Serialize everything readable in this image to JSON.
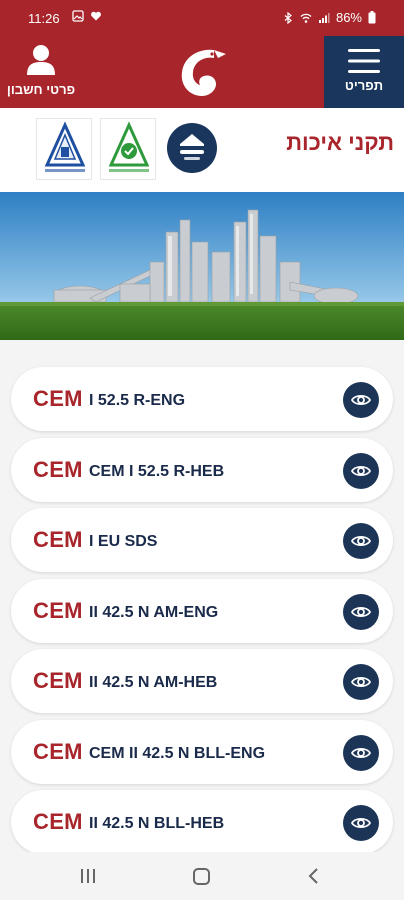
{
  "status_bar": {
    "time": "11:26",
    "battery": "86%"
  },
  "header": {
    "account_label": "פרטי חשבון",
    "menu_label": "תפריט"
  },
  "page": {
    "title": "תקני איכות"
  },
  "documents": [
    {
      "prefix": "CEM",
      "name": "I 52.5 R-ENG"
    },
    {
      "prefix": "CEM",
      "name": "CEM I 52.5 R-HEB"
    },
    {
      "prefix": "CEM",
      "name": "I EU SDS"
    },
    {
      "prefix": "CEM",
      "name": "II 42.5 N AM-ENG"
    },
    {
      "prefix": "CEM",
      "name": "II 42.5 N AM-HEB"
    },
    {
      "prefix": "CEM",
      "name": "CEM II 42.5 N BLL-ENG"
    },
    {
      "prefix": "CEM",
      "name": "II 42.5 N BLL-HEB"
    }
  ],
  "icons": {
    "account": "user-icon",
    "menu": "hamburger-icon",
    "view": "eye-icon",
    "logo": "eagle-logo"
  },
  "colors": {
    "brand_red": "#a8252b",
    "navy": "#1a365d",
    "text_dark": "#1a2a4a"
  }
}
